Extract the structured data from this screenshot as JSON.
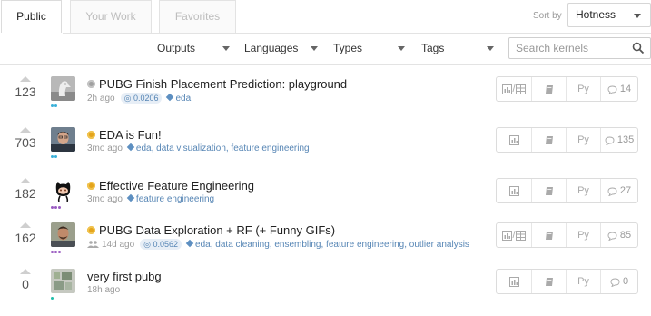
{
  "tabs": [
    {
      "label": "Public",
      "active": true
    },
    {
      "label": "Your Work",
      "active": false
    },
    {
      "label": "Favorites",
      "active": false
    }
  ],
  "sort": {
    "label": "Sort by",
    "value": "Hotness"
  },
  "filters": {
    "outputs": "Outputs",
    "languages": "Languages",
    "types": "Types",
    "tags": "Tags",
    "search_placeholder": "Search kernels"
  },
  "kernels": [
    {
      "votes": "123",
      "title": "PUBG Finish Placement Prediction: playground",
      "status": "gray",
      "age": "2h ago",
      "score": "0.0206",
      "tags": "eda",
      "language": "Py",
      "comments": "14",
      "output_icon": "chart-table",
      "tier_color": "#3ab0d9",
      "tier_count": 2,
      "team": false
    },
    {
      "votes": "703",
      "title": "EDA is Fun!",
      "status": "gold",
      "age": "3mo ago",
      "score": "",
      "tags": "eda, data visualization, feature engineering",
      "language": "Py",
      "comments": "135",
      "output_icon": "chart",
      "tier_color": "#3ab0d9",
      "tier_count": 2,
      "team": false
    },
    {
      "votes": "182",
      "title": "Effective Feature Engineering",
      "status": "gold",
      "age": "3mo ago",
      "score": "",
      "tags": "feature engineering",
      "language": "Py",
      "comments": "27",
      "output_icon": "chart",
      "tier_color": "#9a5cc2",
      "tier_count": 3,
      "team": false
    },
    {
      "votes": "162",
      "title": "PUBG Data Exploration + RF (+ Funny GIFs)",
      "status": "gold",
      "age": "14d ago",
      "score": "0.0562",
      "tags": "eda, data cleaning, ensembling, feature engineering, outlier analysis",
      "language": "Py",
      "comments": "85",
      "output_icon": "chart-table",
      "tier_color": "#9a5cc2",
      "tier_count": 3,
      "team": true
    },
    {
      "votes": "0",
      "title": "very first pubg",
      "status": "none",
      "age": "18h ago",
      "score": "",
      "tags": "",
      "language": "Py",
      "comments": "0",
      "output_icon": "chart",
      "tier_color": "#20beaa",
      "tier_count": 1,
      "team": false
    }
  ],
  "colors": {
    "accent_blue": "#5786b5",
    "border": "#dcdcdc",
    "status_gold": "#e4a41c",
    "status_gray": "#a0a0a0"
  }
}
